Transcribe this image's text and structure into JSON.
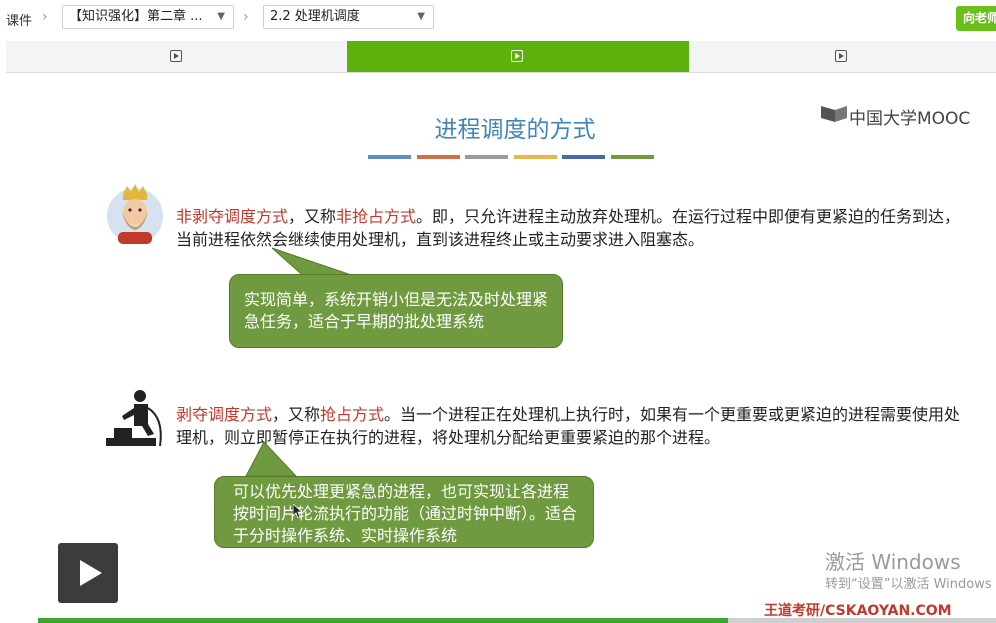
{
  "breadcrumb": {
    "root": "课件",
    "chapter_select": "【知识强化】第二章 ...",
    "section_select": "2.2 处理机调度"
  },
  "ask_teacher_label": "向老师",
  "tabs": [
    {
      "icon": "video-icon",
      "active": false
    },
    {
      "icon": "video-icon",
      "active": true
    },
    {
      "icon": "video-icon",
      "active": false
    }
  ],
  "slide": {
    "title": "进程调度的方式",
    "title_bar_colors": [
      "#5b8fc6",
      "#cf6f47",
      "#9a9a9a",
      "#e6b84b",
      "#4a67a8",
      "#6f9a3f"
    ],
    "logo_text": "中国大学MOOC",
    "section1": {
      "term1": "非剥夺调度方式",
      "mid": "，又称",
      "term2": "非抢占方式",
      "rest": "。即，只允许进程主动放弃处理机。在运行过程中即便有更紧迫的任务到达，当前进程依然会继续使用处理机，直到该进程终止或主动要求进入阻塞态。",
      "note": "实现简单，系统开销小但是无法及时处理紧急任务，适合于早期的批处理系统"
    },
    "section2": {
      "term1": "剥夺调度方式",
      "mid": "，又称",
      "term2": "抢占方式",
      "rest": "。当一个进程正在处理机上执行时，如果有一个更重要或更紧迫的进程需要使用处理机，则立即暂停正在执行的进程，将处理机分配给更重要紧迫的那个进程。",
      "note": "可以优先处理更紧急的进程，也可实现让各进程按时间片轮流执行的功能（通过时钟中断）。适合于分时操作系统、实时操作系统"
    }
  },
  "overlay": {
    "windows_line1": "激活 Windows",
    "windows_line2": "转到“设置”以激活 Windows",
    "watermark": "王道考研/CSKAOYAN.COM"
  },
  "player": {
    "progress": 0.72,
    "accent": "#3aa82e"
  }
}
